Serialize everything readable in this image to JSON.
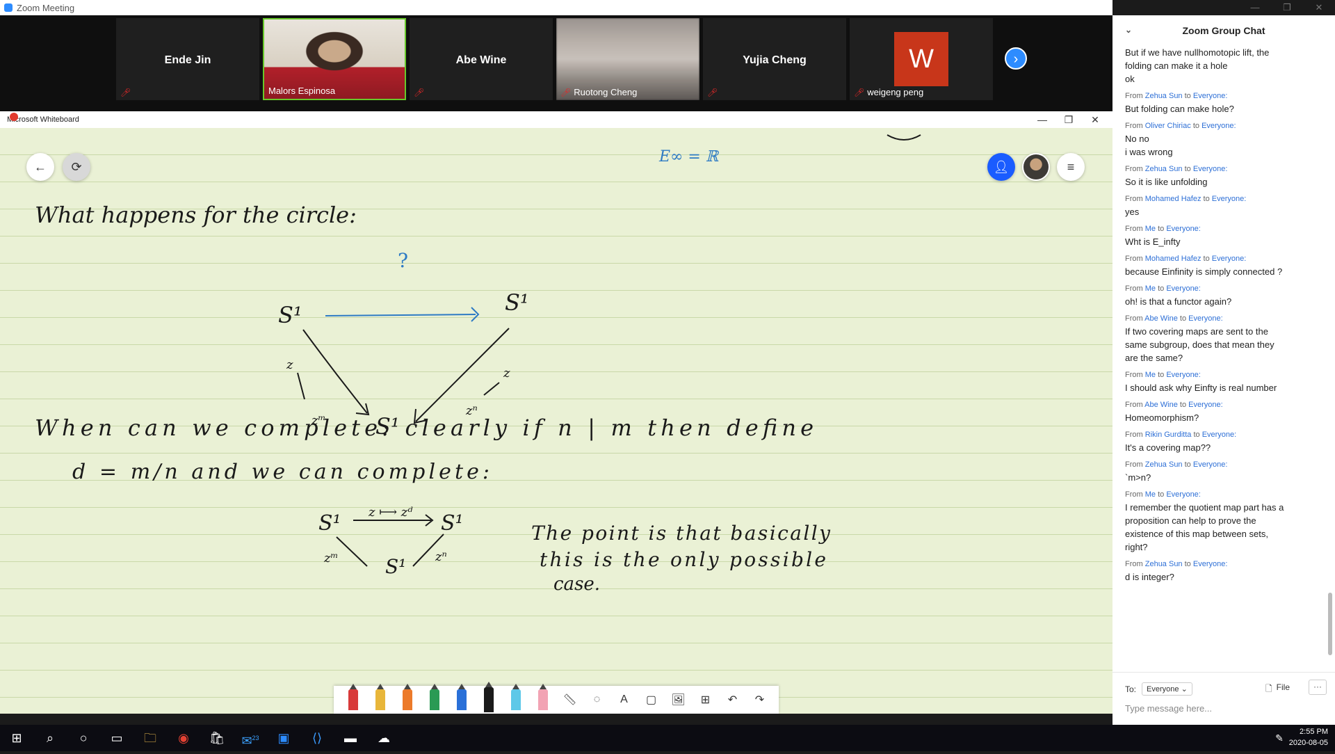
{
  "zoom": {
    "title": "Zoom Meeting",
    "controls": {
      "minimize": "—",
      "restore": "❐",
      "close": "✕"
    }
  },
  "participants": [
    {
      "name": "Ende Jin",
      "label": ""
    },
    {
      "name": "",
      "label": "Malors Espinosa"
    },
    {
      "name": "Abe Wine",
      "label": ""
    },
    {
      "name": "",
      "label": "Ruotong Cheng"
    },
    {
      "name": "Yujia Cheng",
      "label": ""
    },
    {
      "name": "",
      "label": "weigeng peng",
      "avatar": "W"
    }
  ],
  "whiteboard": {
    "title": "Microsoft Whiteboard",
    "controls": {
      "minimize": "—",
      "restore": "❐",
      "close": "✕"
    },
    "ink_texts": {
      "e_infinity": "E∞ = ℝ",
      "line1": "What   happens   for   the   circle:",
      "q": "?",
      "s1a": "S¹",
      "s1b": "S¹",
      "s1c": "S¹",
      "z_left": "z",
      "zm_left": "zᵐ",
      "z_right": "z",
      "zn_right": "zⁿ",
      "line2": "When   can   we   complete:  clearly   if   n | m   then   define",
      "line3": "d = m/n    and    we    can   complete:",
      "s1d": "S¹",
      "map": "z ⟼ zᵈ",
      "s1e": "S¹",
      "s1f": "S¹",
      "zm2": "zᵐ",
      "zn2": "zⁿ",
      "note1": "The   point   is   that   basically",
      "note2": "this    is    the    only    possible",
      "note3": "case."
    }
  },
  "chat": {
    "title": "Zoom Group Chat",
    "messages": [
      {
        "from": "",
        "to": "",
        "lines": [
          "But if we have nullhomotopic lift, the",
          "folding can make it a hole",
          "ok"
        ]
      },
      {
        "from": "Zehua Sun",
        "to": "Everyone:",
        "lines": [
          "But folding can make hole?"
        ]
      },
      {
        "from": "Oliver Chiriac",
        "to": "Everyone:",
        "lines": [
          "No no",
          "i was wrong"
        ]
      },
      {
        "from": "Zehua Sun",
        "to": "Everyone:",
        "lines": [
          "So it is like unfolding"
        ]
      },
      {
        "from": "Mohamed Hafez",
        "to": "Everyone:",
        "lines": [
          "yes"
        ]
      },
      {
        "from": "Me",
        "to": "Everyone:",
        "lines": [
          "Wht is E_infty"
        ]
      },
      {
        "from": "Mohamed Hafez",
        "to": "Everyone:",
        "lines": [
          "because Einfinity is simply connected ?"
        ]
      },
      {
        "from": "Me",
        "to": "Everyone:",
        "lines": [
          "oh! is that a functor again?"
        ]
      },
      {
        "from": "Abe Wine",
        "to": "Everyone:",
        "lines": [
          "If two covering maps are sent to the",
          "same subgroup, does that mean they",
          "are the same?"
        ]
      },
      {
        "from": "Me",
        "to": "Everyone:",
        "lines": [
          "I should ask why Einfty is real number"
        ]
      },
      {
        "from": "Abe Wine",
        "to": "Everyone:",
        "lines": [
          "Homeomorphism?"
        ]
      },
      {
        "from": "Rikin Gurditta",
        "to": "Everyone:",
        "lines": [
          "It's a covering map??"
        ]
      },
      {
        "from": "Zehua Sun",
        "to": "Everyone:",
        "lines": [
          "`m>n?"
        ]
      },
      {
        "from": "Me",
        "to": "Everyone:",
        "lines": [
          "I remember the quotient map part has a",
          "proposition can help to prove the",
          "existence of this map between sets,",
          "right?"
        ]
      },
      {
        "from": "Zehua Sun",
        "to": "Everyone:",
        "lines": [
          "d is integer?"
        ]
      }
    ],
    "from_prefix": "From",
    "to_word": "to",
    "footer": {
      "to_label": "To:",
      "recipient": "Everyone",
      "file": "File",
      "more": "···",
      "placeholder": "Type message here..."
    }
  },
  "taskbar": {
    "time": "2:55 PM",
    "date": "2020-08-05",
    "mail_badge": "23"
  }
}
